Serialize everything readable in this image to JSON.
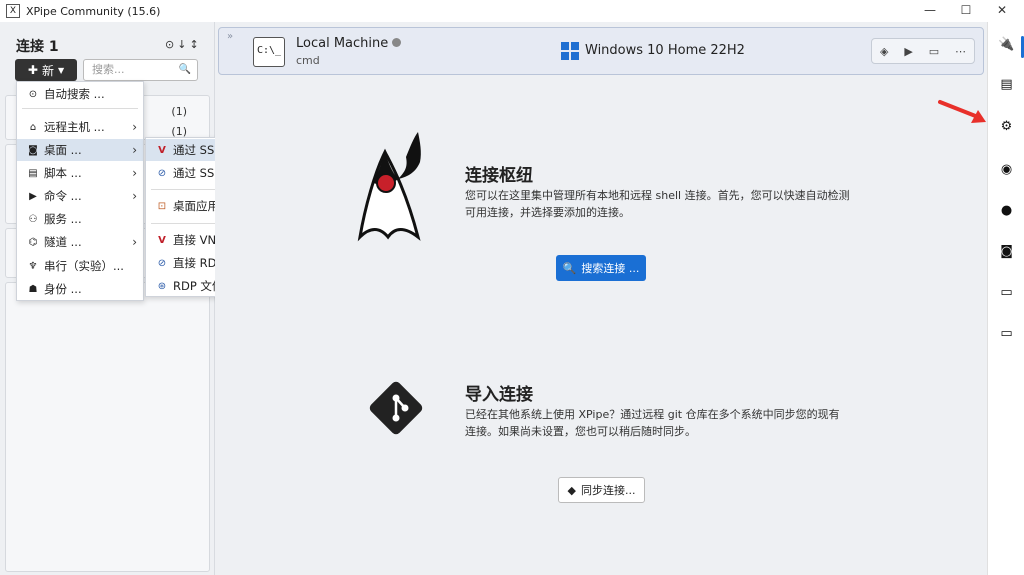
{
  "window": {
    "title": "XPipe Community (15.6)",
    "app_icon": "x-square-icon",
    "controls": [
      "—",
      "☐",
      "✕"
    ]
  },
  "left": {
    "heading": "连接 1",
    "new_label": "新",
    "search_placeholder": "搜索...",
    "counts": [
      "(1)",
      "(1)"
    ]
  },
  "new_menu": {
    "items": [
      {
        "label": "自动搜索 ...",
        "icon": "auto-search-icon",
        "arrow": false
      },
      {
        "label": "远程主机 ...",
        "icon": "remote-host-icon",
        "arrow": true
      },
      {
        "label": "桌面 ...",
        "icon": "desktop-icon",
        "arrow": true
      },
      {
        "label": "脚本 ...",
        "icon": "script-icon",
        "arrow": true
      },
      {
        "label": "命令 ...",
        "icon": "command-icon",
        "arrow": true
      },
      {
        "label": "服务 ...",
        "icon": "service-icon",
        "arrow": false
      },
      {
        "label": "隧道 ...",
        "icon": "tunnel-icon",
        "arrow": true
      },
      {
        "label": "串行（实验）...",
        "icon": "serial-icon",
        "arrow": false
      },
      {
        "label": "身份 ...",
        "icon": "identity-icon",
        "arrow": false
      }
    ]
  },
  "desktop_submenu": {
    "items": [
      {
        "label": "通过 SSH 进行 VNC 连接",
        "icon": "vnc-icon"
      },
      {
        "label": "通过 SSH 进行 RDP 连接",
        "icon": "rdp-icon"
      },
      {
        "label": "桌面应用程序",
        "icon": "terminal-app-icon"
      },
      {
        "label": "直接 VNC 连接",
        "icon": "vnc-icon"
      },
      {
        "label": "直接 RDP 连接",
        "icon": "rdp-icon"
      },
      {
        "label": "RDP 文件",
        "icon": "rdp-file-icon"
      }
    ]
  },
  "machine": {
    "name": "Local Machine",
    "shell": "cmd",
    "os": "Windows 10 Home 22H2",
    "terminal_glyph": "C:\\_"
  },
  "hub": {
    "title": "连接枢纽",
    "desc": "您可以在这里集中管理所有本地和远程 shell 连接。首先，您可以快速自动检测可用连接，并选择要添加的连接。",
    "button": "搜索连接 ..."
  },
  "import": {
    "title": "导入连接",
    "desc": "已经在其他系统上使用 XPipe？通过远程 git 仓库在多个系统中同步您的现有连接。如果尚未设置，您也可以稍后随时同步。",
    "button": "同步连接..."
  },
  "right_bar": {
    "icons": [
      "connections-icon",
      "storage-icon",
      "settings-icon",
      "pro-icon",
      "github-icon",
      "discord-icon",
      "docs-icon",
      "desktop-icon"
    ]
  },
  "colors": {
    "accent": "#1a6fd4",
    "arrow": "#e8302a",
    "highlight": "#d9e3ef"
  }
}
